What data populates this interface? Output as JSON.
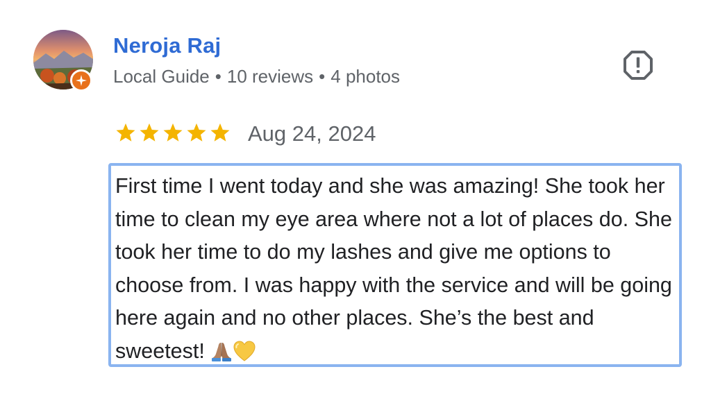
{
  "author": {
    "name": "Neroja Raj",
    "badge": "Local Guide",
    "reviews": "10 reviews",
    "photos": "4 photos"
  },
  "review": {
    "rating": 5,
    "rating_max": 5,
    "date": "Aug 24, 2024",
    "text": "First time I went today and she was amazing! She took her time to clean my eye area where not a lot of places do. She took her time to do my lashes and give me options to choose from. I was happy with the service and will be going here again and no other places. She’s the best and sweetest!"
  },
  "icons": {
    "report": "report-flag-icon",
    "badge": "local-guide-star-icon",
    "star": "star-icon",
    "emoji_1": "folded-hands-emoji",
    "emoji_2": "yellow-heart-emoji"
  },
  "colors": {
    "author_name": "#2f6bd4",
    "star": "#f4b400",
    "badge": "#e8711c",
    "selection_border": "#8ab4f0"
  }
}
